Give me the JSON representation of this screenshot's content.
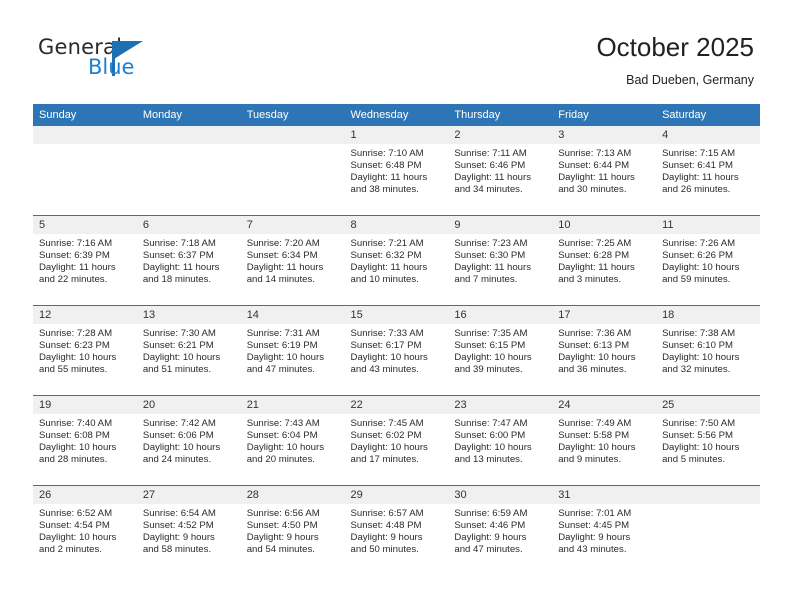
{
  "brand": {
    "name_top": "General",
    "name_bottom": "Blue",
    "color_primary": "#1f6fb5",
    "color_secondary": "#1f7fd0"
  },
  "header": {
    "month_title": "October 2025",
    "location": "Bad Dueben, Germany"
  },
  "theme": {
    "header_row_bg": "#2e75b6",
    "daynum_bg": "#f0f0f0",
    "separator": "#2e75b6",
    "text": "#2b2b2b"
  },
  "weekday_headers": [
    "Sunday",
    "Monday",
    "Tuesday",
    "Wednesday",
    "Thursday",
    "Friday",
    "Saturday"
  ],
  "weeks": [
    [
      {
        "day": "",
        "empty": true
      },
      {
        "day": "",
        "empty": true
      },
      {
        "day": "",
        "empty": true
      },
      {
        "day": "1",
        "sunrise": "Sunrise: 7:10 AM",
        "sunset": "Sunset: 6:48 PM",
        "daylight": "Daylight: 11 hours and 38 minutes."
      },
      {
        "day": "2",
        "sunrise": "Sunrise: 7:11 AM",
        "sunset": "Sunset: 6:46 PM",
        "daylight": "Daylight: 11 hours and 34 minutes."
      },
      {
        "day": "3",
        "sunrise": "Sunrise: 7:13 AM",
        "sunset": "Sunset: 6:44 PM",
        "daylight": "Daylight: 11 hours and 30 minutes."
      },
      {
        "day": "4",
        "sunrise": "Sunrise: 7:15 AM",
        "sunset": "Sunset: 6:41 PM",
        "daylight": "Daylight: 11 hours and 26 minutes."
      }
    ],
    [
      {
        "day": "5",
        "sunrise": "Sunrise: 7:16 AM",
        "sunset": "Sunset: 6:39 PM",
        "daylight": "Daylight: 11 hours and 22 minutes."
      },
      {
        "day": "6",
        "sunrise": "Sunrise: 7:18 AM",
        "sunset": "Sunset: 6:37 PM",
        "daylight": "Daylight: 11 hours and 18 minutes."
      },
      {
        "day": "7",
        "sunrise": "Sunrise: 7:20 AM",
        "sunset": "Sunset: 6:34 PM",
        "daylight": "Daylight: 11 hours and 14 minutes."
      },
      {
        "day": "8",
        "sunrise": "Sunrise: 7:21 AM",
        "sunset": "Sunset: 6:32 PM",
        "daylight": "Daylight: 11 hours and 10 minutes."
      },
      {
        "day": "9",
        "sunrise": "Sunrise: 7:23 AM",
        "sunset": "Sunset: 6:30 PM",
        "daylight": "Daylight: 11 hours and 7 minutes."
      },
      {
        "day": "10",
        "sunrise": "Sunrise: 7:25 AM",
        "sunset": "Sunset: 6:28 PM",
        "daylight": "Daylight: 11 hours and 3 minutes."
      },
      {
        "day": "11",
        "sunrise": "Sunrise: 7:26 AM",
        "sunset": "Sunset: 6:26 PM",
        "daylight": "Daylight: 10 hours and 59 minutes."
      }
    ],
    [
      {
        "day": "12",
        "sunrise": "Sunrise: 7:28 AM",
        "sunset": "Sunset: 6:23 PM",
        "daylight": "Daylight: 10 hours and 55 minutes."
      },
      {
        "day": "13",
        "sunrise": "Sunrise: 7:30 AM",
        "sunset": "Sunset: 6:21 PM",
        "daylight": "Daylight: 10 hours and 51 minutes."
      },
      {
        "day": "14",
        "sunrise": "Sunrise: 7:31 AM",
        "sunset": "Sunset: 6:19 PM",
        "daylight": "Daylight: 10 hours and 47 minutes."
      },
      {
        "day": "15",
        "sunrise": "Sunrise: 7:33 AM",
        "sunset": "Sunset: 6:17 PM",
        "daylight": "Daylight: 10 hours and 43 minutes."
      },
      {
        "day": "16",
        "sunrise": "Sunrise: 7:35 AM",
        "sunset": "Sunset: 6:15 PM",
        "daylight": "Daylight: 10 hours and 39 minutes."
      },
      {
        "day": "17",
        "sunrise": "Sunrise: 7:36 AM",
        "sunset": "Sunset: 6:13 PM",
        "daylight": "Daylight: 10 hours and 36 minutes."
      },
      {
        "day": "18",
        "sunrise": "Sunrise: 7:38 AM",
        "sunset": "Sunset: 6:10 PM",
        "daylight": "Daylight: 10 hours and 32 minutes."
      }
    ],
    [
      {
        "day": "19",
        "sunrise": "Sunrise: 7:40 AM",
        "sunset": "Sunset: 6:08 PM",
        "daylight": "Daylight: 10 hours and 28 minutes."
      },
      {
        "day": "20",
        "sunrise": "Sunrise: 7:42 AM",
        "sunset": "Sunset: 6:06 PM",
        "daylight": "Daylight: 10 hours and 24 minutes."
      },
      {
        "day": "21",
        "sunrise": "Sunrise: 7:43 AM",
        "sunset": "Sunset: 6:04 PM",
        "daylight": "Daylight: 10 hours and 20 minutes."
      },
      {
        "day": "22",
        "sunrise": "Sunrise: 7:45 AM",
        "sunset": "Sunset: 6:02 PM",
        "daylight": "Daylight: 10 hours and 17 minutes."
      },
      {
        "day": "23",
        "sunrise": "Sunrise: 7:47 AM",
        "sunset": "Sunset: 6:00 PM",
        "daylight": "Daylight: 10 hours and 13 minutes."
      },
      {
        "day": "24",
        "sunrise": "Sunrise: 7:49 AM",
        "sunset": "Sunset: 5:58 PM",
        "daylight": "Daylight: 10 hours and 9 minutes."
      },
      {
        "day": "25",
        "sunrise": "Sunrise: 7:50 AM",
        "sunset": "Sunset: 5:56 PM",
        "daylight": "Daylight: 10 hours and 5 minutes."
      }
    ],
    [
      {
        "day": "26",
        "sunrise": "Sunrise: 6:52 AM",
        "sunset": "Sunset: 4:54 PM",
        "daylight": "Daylight: 10 hours and 2 minutes."
      },
      {
        "day": "27",
        "sunrise": "Sunrise: 6:54 AM",
        "sunset": "Sunset: 4:52 PM",
        "daylight": "Daylight: 9 hours and 58 minutes."
      },
      {
        "day": "28",
        "sunrise": "Sunrise: 6:56 AM",
        "sunset": "Sunset: 4:50 PM",
        "daylight": "Daylight: 9 hours and 54 minutes."
      },
      {
        "day": "29",
        "sunrise": "Sunrise: 6:57 AM",
        "sunset": "Sunset: 4:48 PM",
        "daylight": "Daylight: 9 hours and 50 minutes."
      },
      {
        "day": "30",
        "sunrise": "Sunrise: 6:59 AM",
        "sunset": "Sunset: 4:46 PM",
        "daylight": "Daylight: 9 hours and 47 minutes."
      },
      {
        "day": "31",
        "sunrise": "Sunrise: 7:01 AM",
        "sunset": "Sunset: 4:45 PM",
        "daylight": "Daylight: 9 hours and 43 minutes."
      },
      {
        "day": "",
        "empty": true
      }
    ]
  ]
}
